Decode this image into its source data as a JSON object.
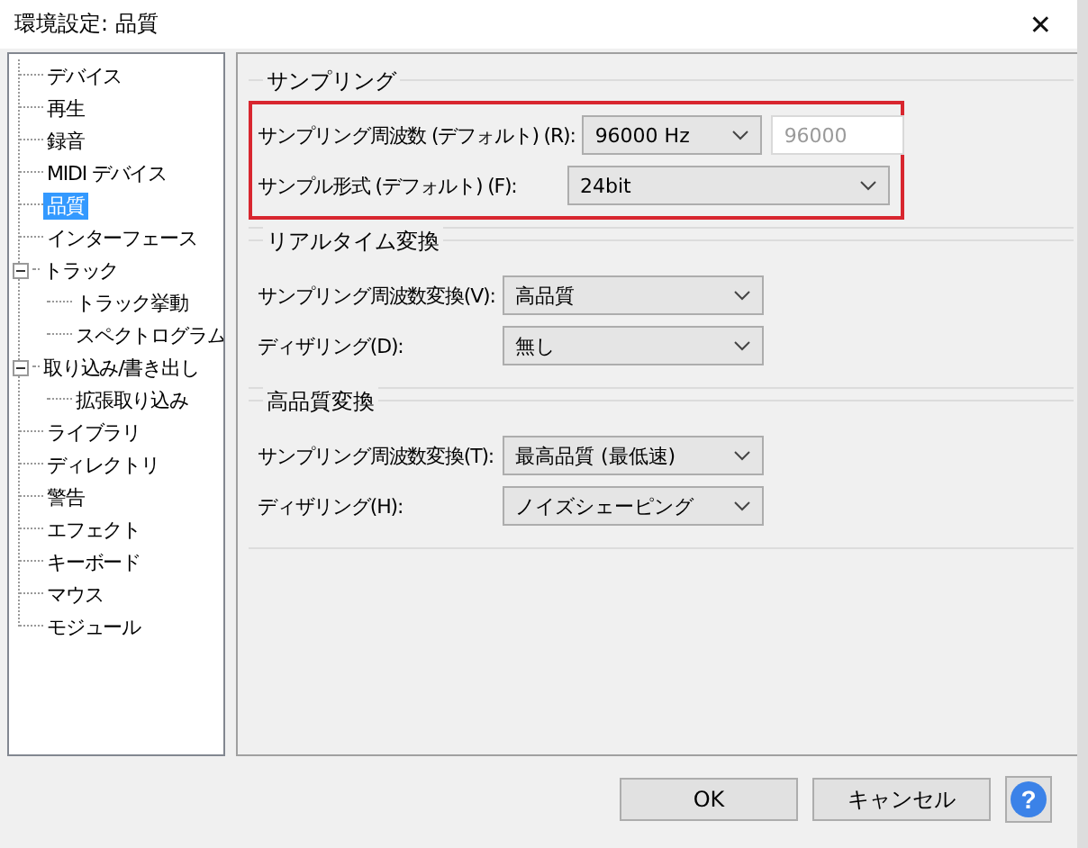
{
  "window": {
    "title": "環境設定: 品質",
    "close": "✕"
  },
  "tree": [
    {
      "label": "デバイス",
      "selected": false
    },
    {
      "label": "再生",
      "selected": false
    },
    {
      "label": "録音",
      "selected": false
    },
    {
      "label": "MIDI デバイス",
      "selected": false
    },
    {
      "label": "品質",
      "selected": true
    },
    {
      "label": "インターフェース",
      "selected": false
    },
    {
      "label": "トラック",
      "selected": false,
      "expanded": true,
      "children": [
        {
          "label": "トラック挙動",
          "selected": false
        },
        {
          "label": "スペクトログラム",
          "selected": false
        }
      ]
    },
    {
      "label": "取り込み/書き出し",
      "selected": false,
      "expanded": true,
      "children": [
        {
          "label": "拡張取り込み",
          "selected": false
        }
      ]
    },
    {
      "label": "ライブラリ",
      "selected": false
    },
    {
      "label": "ディレクトリ",
      "selected": false
    },
    {
      "label": "警告",
      "selected": false
    },
    {
      "label": "エフェクト",
      "selected": false
    },
    {
      "label": "キーボード",
      "selected": false
    },
    {
      "label": "マウス",
      "selected": false
    },
    {
      "label": "モジュール",
      "selected": false
    }
  ],
  "sections": [
    {
      "title": "サンプリング",
      "highlighted": true,
      "rows": [
        {
          "label": "サンプリング周波数 (デフォルト) (R):",
          "kind": "combo_field",
          "value": "96000 Hz",
          "field": {
            "value": "96000",
            "disabled": true
          }
        },
        {
          "label": "サンプル形式 (デフォルト) (F):",
          "kind": "combo_wide",
          "value": "24bit"
        }
      ]
    },
    {
      "title": "リアルタイム変換",
      "highlighted": false,
      "rows": [
        {
          "label": "サンプリング周波数変換(V):",
          "kind": "combo",
          "value": "高品質"
        },
        {
          "label": "ディザリング(D):",
          "kind": "combo",
          "value": "無し"
        }
      ]
    },
    {
      "title": "高品質変換",
      "highlighted": false,
      "rows": [
        {
          "label": "サンプリング周波数変換(T):",
          "kind": "combo",
          "value": "最高品質 (最低速)"
        },
        {
          "label": "ディザリング(H):",
          "kind": "combo",
          "value": "ノイズシェーピング"
        }
      ]
    }
  ],
  "buttons": [
    {
      "label": "OK",
      "kind": "text"
    },
    {
      "label": "キャンセル",
      "kind": "text"
    },
    {
      "label": "?",
      "kind": "help"
    }
  ]
}
